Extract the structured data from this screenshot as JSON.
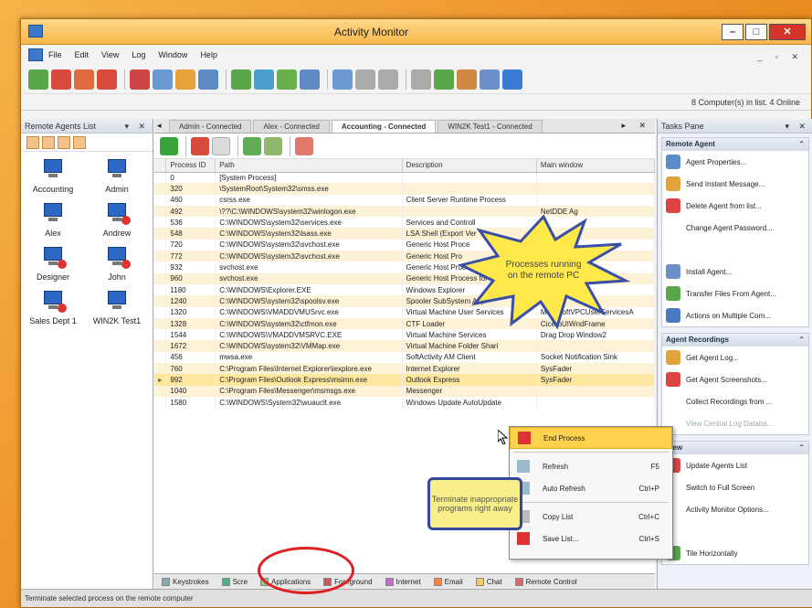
{
  "window": {
    "title": "Activity Monitor",
    "min": "–",
    "max": "□",
    "close": "✕",
    "mdi_controls": "_ ▫ ✕"
  },
  "menu": [
    "File",
    "Edit",
    "View",
    "Log",
    "Window",
    "Help"
  ],
  "countbar": "8 Computer(s) in list. 4 Online",
  "left_panel": {
    "title": "Remote Agents List",
    "controls": "▾ ✕",
    "agents": [
      {
        "name": "Accounting",
        "online": true
      },
      {
        "name": "Admin",
        "online": true
      },
      {
        "name": "Alex",
        "online": true
      },
      {
        "name": "Andrew",
        "online": false
      },
      {
        "name": "Designer",
        "online": false
      },
      {
        "name": "John",
        "online": false
      },
      {
        "name": "Sales Dept 1",
        "online": false
      },
      {
        "name": "WIN2K Test1",
        "online": true
      }
    ]
  },
  "tabs": [
    {
      "label": "Admin - Connected",
      "active": false
    },
    {
      "label": "Alex - Connected",
      "active": false
    },
    {
      "label": "Accounting - Connected",
      "active": true
    },
    {
      "label": "WIN2K Test1 - Connected",
      "active": false
    }
  ],
  "tab_nav": {
    "left": "◂",
    "right": "▸ ✕"
  },
  "columns": [
    "Process ID",
    "Path",
    "Description",
    "Main window"
  ],
  "rows": [
    {
      "id": "0",
      "path": "[System Process]",
      "desc": "",
      "win": ""
    },
    {
      "id": "320",
      "path": "\\SystemRoot\\System32\\smss.exe",
      "desc": "",
      "win": ""
    },
    {
      "id": "460",
      "path": "csrss.exe",
      "desc": "Client Server Runtime Process",
      "win": ""
    },
    {
      "id": "492",
      "path": "\\??\\C:\\WINDOWS\\system32\\winlogon.exe",
      "desc": "",
      "win": "NetDDE Ag"
    },
    {
      "id": "536",
      "path": "C:\\WINDOWS\\system32\\services.exe",
      "desc": "Services and Controll",
      "win": ""
    },
    {
      "id": "548",
      "path": "C:\\WINDOWS\\system32\\lsass.exe",
      "desc": "LSA Shell (Export Ver",
      "win": ""
    },
    {
      "id": "720",
      "path": "C:\\WINDOWS\\system32\\svchost.exe",
      "desc": "Generic Host Proce",
      "win": ""
    },
    {
      "id": "772",
      "path": "C:\\WINDOWS\\system32\\svchost.exe",
      "desc": "Generic Host Pro",
      "win": ""
    },
    {
      "id": "932",
      "path": "svchost.exe",
      "desc": "Generic Host Process",
      "win": ""
    },
    {
      "id": "960",
      "path": "svchost.exe",
      "desc": "Generic Host Process for Wi",
      "win": ""
    },
    {
      "id": "1180",
      "path": "C:\\WINDOWS\\Explorer.EXE",
      "desc": "Windows Explorer",
      "win": "Start Menu"
    },
    {
      "id": "1240",
      "path": "C:\\WINDOWS\\system32\\spoolsv.exe",
      "desc": "Spooler SubSystem App",
      "win": ""
    },
    {
      "id": "1320",
      "path": "C:\\WINDOWS\\VMADDVMUSrvc.exe",
      "desc": "Virtual Machine User Services",
      "win": "MicrosoftVPCUserServicesA"
    },
    {
      "id": "1328",
      "path": "C:\\WINDOWS\\system32\\ctfmon.exe",
      "desc": "CTF Loader",
      "win": "CiceroUIWndFrame"
    },
    {
      "id": "1544",
      "path": "C:\\WINDOWS\\VMADDVMSRVC.EXE",
      "desc": "Virtual Machine Services",
      "win": "Drag Drop Window2"
    },
    {
      "id": "1672",
      "path": "C:\\WINDOWS\\system32\\VMMap.exe",
      "desc": "Virtual Machine Folder Shari",
      "win": ""
    },
    {
      "id": "456",
      "path": "mwsa.exe",
      "desc": "SoftActivity AM Client",
      "win": "Socket Notification Sink"
    },
    {
      "id": "760",
      "path": "C:\\Program Files\\Internet Explorer\\iexplore.exe",
      "desc": "Internet Explorer",
      "win": "SysFader"
    },
    {
      "id": "992",
      "path": "C:\\Program Files\\Outlook Express\\msimn.exe",
      "desc": "Outlook Express",
      "win": "SysFader",
      "selected": true
    },
    {
      "id": "1040",
      "path": "C:\\Program Files\\Messenger\\msmsgs.exe",
      "desc": "Messenger",
      "win": ""
    },
    {
      "id": "1580",
      "path": "C:\\WINDOWS\\System32\\wuauclt.exe",
      "desc": "Windows Update AutoUpdate",
      "win": ""
    }
  ],
  "bottom_tabs": [
    "Keystrokes",
    "Scre",
    "Applications",
    "Foreground",
    "Internet",
    "Email",
    "Chat",
    "Remote Control"
  ],
  "tasks_pane": {
    "title": "Tasks Pane",
    "controls": "▾ ✕",
    "groups": [
      {
        "title": "Remote Agent",
        "items": [
          "Agent Properties...",
          "Send Instant Message...",
          "Delete Agent from list...",
          "Change Agent Password...",
          "",
          "Install Agent...",
          "Transfer Files From Agent...",
          "Actions on Multiple Com..."
        ]
      },
      {
        "title": "Agent Recordings",
        "items": [
          "Get Agent Log...",
          "Get Agent Screenshots...",
          "Collect Recordings from ...",
          "View Central Log Databa..."
        ]
      },
      {
        "title": "View",
        "items": [
          "Update Agents List",
          "Switch to Full Screen",
          "Activity Monitor Options...",
          "",
          "Tile Horizontally"
        ]
      }
    ]
  },
  "context_menu": [
    {
      "label": "End Process",
      "shortcut": "",
      "highlight": true
    },
    {
      "label": "Refresh",
      "shortcut": "F5"
    },
    {
      "label": "Auto Refresh",
      "shortcut": "Ctrl+P"
    },
    {
      "label": "Copy List",
      "shortcut": "Ctrl+C"
    },
    {
      "label": "Save List...",
      "shortcut": "Ctrl+S"
    }
  ],
  "callout_burst": "Processes running on the remote PC",
  "callout_box": "Terminate inappropriate programs right away",
  "status": "Terminate selected process on the remote computer",
  "colors": {
    "accent": "#f7b64a",
    "selection": "#ffe7a0",
    "circle": "#e02020",
    "callout_border": "#32489b"
  }
}
